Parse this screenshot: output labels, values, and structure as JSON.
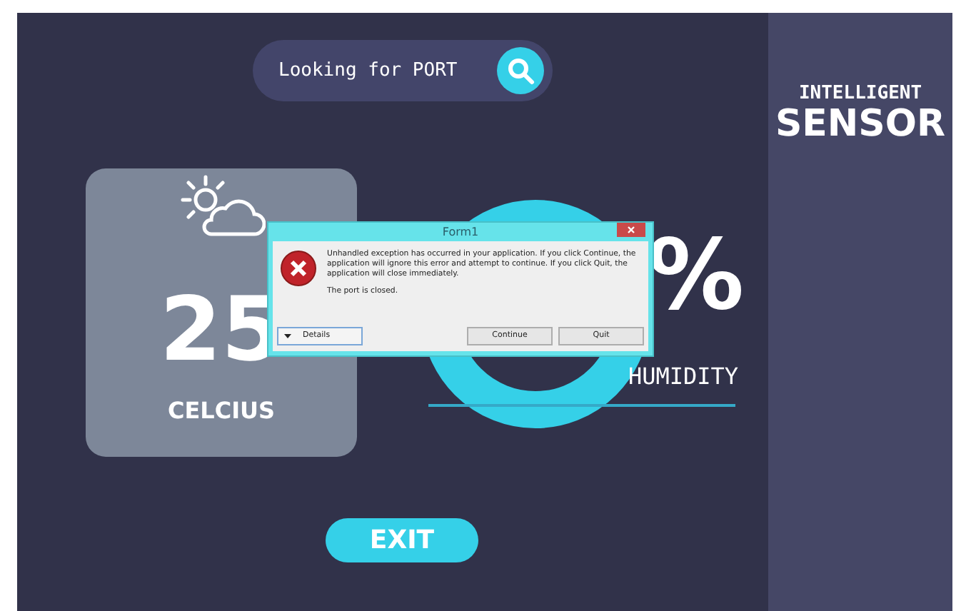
{
  "search": {
    "label": "Looking for PORT"
  },
  "temperature": {
    "value": "25",
    "unit": "CELCIUS"
  },
  "humidity": {
    "value": "%",
    "label": "HUMIDITY"
  },
  "exit_button": "EXIT",
  "sidebar": {
    "subtitle": "INTELLIGENT",
    "title": "SENSOR"
  },
  "dialog": {
    "title": "Form1",
    "message": "Unhandled exception has occurred in your application. If you click Continue, the application will ignore this error and attempt to continue. If you click Quit, the application will close immediately.",
    "detail": "The port is closed.",
    "details_button": "Details",
    "buttons": [
      "Continue",
      "Quit"
    ]
  }
}
